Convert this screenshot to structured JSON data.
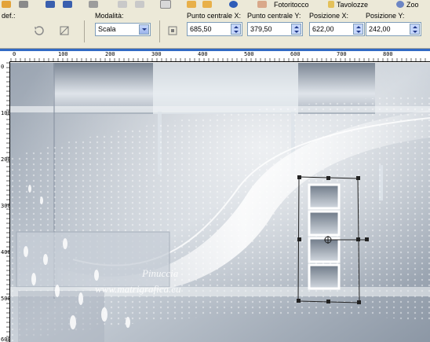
{
  "top_toolbar": {
    "items": [
      {
        "label": "Fotoritocco",
        "icon": "photo-fix-icon"
      },
      {
        "label": "Tavolozze",
        "icon": "palettes-icon"
      },
      {
        "label": "Zoo",
        "icon": "zoom-icon"
      }
    ]
  },
  "options": {
    "preset_label": "def.:",
    "mode_label": "Modalità:",
    "mode_value": "Scala",
    "center_x_label": "Punto centrale X:",
    "center_x_value": "685,50",
    "center_y_label": "Punto centrale Y:",
    "center_y_value": "379,50",
    "position_x_label": "Posizione X:",
    "position_x_value": "622,00",
    "position_y_label": "Posizione Y:",
    "position_y_value": "242,00"
  },
  "ruler": {
    "horizontal_labels": [
      "0",
      "100",
      "200",
      "300",
      "400",
      "500",
      "600",
      "700",
      "800"
    ],
    "vertical_labels": [
      "0",
      "100",
      "200",
      "300",
      "400",
      "500",
      "600"
    ]
  },
  "canvas": {
    "watermark_line1": "Pinuccia",
    "watermark_line2": "www.matrigrafica.eu"
  },
  "colors": {
    "selection_blue": "#316ac5",
    "toolbar_bg": "#ece9d8",
    "image_base": "#b3bcc7"
  }
}
